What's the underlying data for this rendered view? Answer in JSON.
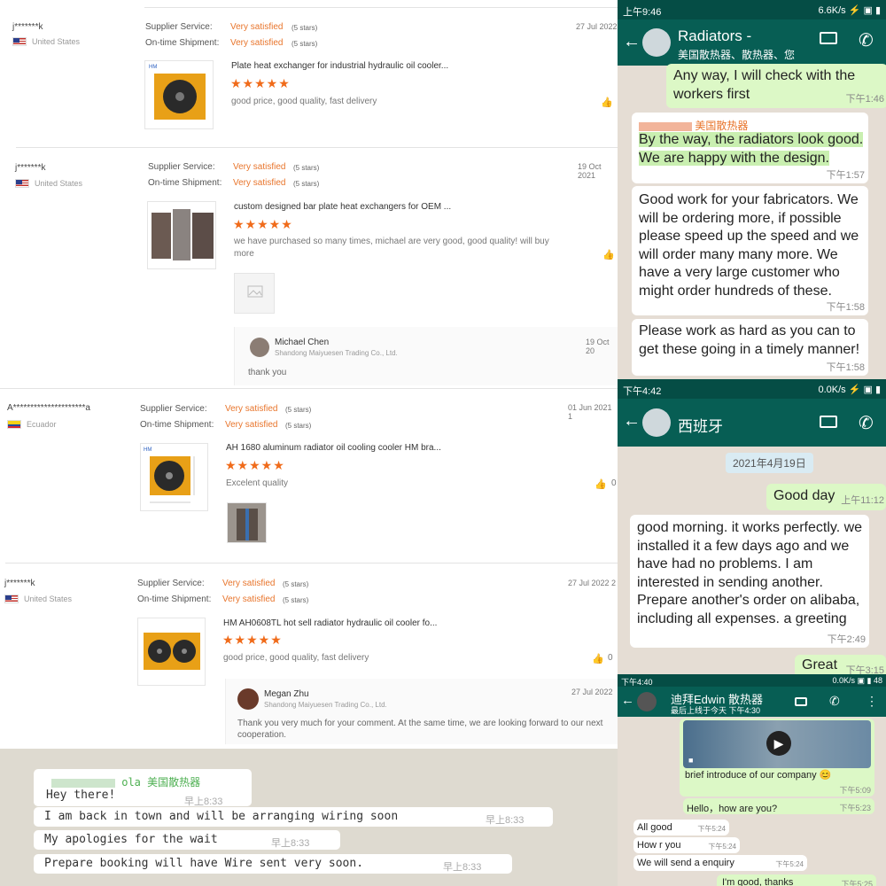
{
  "reviews": [
    {
      "user": "j*******k",
      "country": "United States",
      "flag": "us",
      "supplier_label": "Supplier Service:",
      "supplier_value": "Very satisfied",
      "supplier_stars": "(5 stars)",
      "shipment_label": "On-time Shipment:",
      "shipment_value": "Very satisfied",
      "shipment_stars": "(5 stars)",
      "date": "27 Jul 2022",
      "product": "Plate heat exchanger for industrial hydraulic oil cooler...",
      "stars": "★★★★★",
      "comment": "good price, good quality, fast delivery",
      "likes": ""
    },
    {
      "user": "j*******k",
      "country": "United States",
      "flag": "us",
      "supplier_label": "Supplier Service:",
      "supplier_value": "Very satisfied",
      "supplier_stars": "(5 stars)",
      "shipment_label": "On-time Shipment:",
      "shipment_value": "Very satisfied",
      "shipment_stars": "(5 stars)",
      "date": "19 Oct 2021",
      "product": "custom designed bar plate heat exchangers for OEM ...",
      "stars": "★★★★★",
      "comment": "we have purchased so many times, michael are very good, good quality! will buy more",
      "likes": "",
      "reply": {
        "name": "Michael Chen",
        "company": "Shandong Maiyuesen Trading Co., Ltd.",
        "date": "19 Oct 20",
        "text": "thank you"
      }
    },
    {
      "user": "A*********************a",
      "country": "Ecuador",
      "flag": "ec",
      "supplier_label": "Supplier Service:",
      "supplier_value": "Very satisfied",
      "supplier_stars": "(5 stars)",
      "shipment_label": "On-time Shipment:",
      "shipment_value": "Very satisfied",
      "shipment_stars": "(5 stars)",
      "date": "01 Jun 2021 1",
      "product": "AH 1680 aluminum radiator oil cooling cooler HM bra...",
      "stars": "★★★★★",
      "comment": "Excelent quality",
      "likes": "0"
    },
    {
      "user": "j*******k",
      "country": "United States",
      "flag": "us",
      "supplier_label": "Supplier Service:",
      "supplier_value": "Very satisfied",
      "supplier_stars": "(5 stars)",
      "shipment_label": "On-time Shipment:",
      "shipment_value": "Very satisfied",
      "shipment_stars": "(5 stars)",
      "date": "27 Jul 2022 2",
      "product": "HM AH0608TL hot sell radiator hydraulic oil cooler fo...",
      "stars": "★★★★★",
      "comment": "good price, good quality, fast delivery",
      "likes": "0",
      "reply": {
        "name": "Megan Zhu",
        "company": "Shandong Maiyuesen Trading Co., Ltd.",
        "date": "27 Jul 2022",
        "text": "Thank you very much for your comment. At the same time, we are looking forward to our next cooperation."
      }
    }
  ],
  "chat1": {
    "status_time": "上午9:46",
    "status_right": "6.6K/s ⚡ ▣ ▮",
    "title": "Radiators -",
    "subtitle": "美国散热器、散热器、您",
    "messages": [
      {
        "text": "Any way, I will check with the workers first",
        "time": "下午1:46"
      },
      {
        "sender": "美国散热器",
        "text": "By the way, the radiators look good. We are happy with the design.",
        "time": "下午1:57"
      },
      {
        "text": "Good work for your fabricators.  We will be ordering more, if possible please speed up the speed and we will order many many more.  We have a very large customer who might order hundreds of these.",
        "time": "下午1:58"
      },
      {
        "text": "Please work as hard as you can to get these going in a timely manner!",
        "time": "下午1:58"
      }
    ]
  },
  "chat2": {
    "status_time": "下午4:42",
    "status_right": "0.0K/s ⚡ ▣ ▮",
    "title": "西班牙",
    "date_chip": "2021年4月19日",
    "messages": [
      {
        "text": "Good day",
        "time": "上午11:12"
      },
      {
        "text": "good morning. it works perfectly. we installed it a few days ago and we have had no problems. I am interested in sending another. Prepare another's order on alibaba, including all expenses. a greeting",
        "time": "下午2:49"
      },
      {
        "text": "Great",
        "time": "下午3:15"
      }
    ]
  },
  "chat3": {
    "status_time": "下午4:40",
    "status_right": "0.0K/s ▣ ▮ 48",
    "title": "迪拜Edwin 散热器",
    "subtitle": "最后上线于今天 下午4:30",
    "messages": [
      {
        "text": "brief introduce of our company 😊",
        "time": "下午5:09"
      },
      {
        "text": "Hello，how are you?",
        "time": "下午5:23"
      },
      {
        "text": "All good",
        "time": "下午5:24"
      },
      {
        "text": "How r you",
        "time": "下午5:24"
      },
      {
        "text": "We will send a enquiry",
        "time": "下午5:24"
      },
      {
        "text": "I'm good, thanks",
        "time": "下午5:25"
      }
    ]
  },
  "chat4": {
    "sender": "ola 美国散热器",
    "messages": [
      {
        "text": "Hey there!",
        "time": "早上8:33"
      },
      {
        "text": "I am back in town and will be arranging wiring soon",
        "time": "早上8:33"
      },
      {
        "text": "My apologies for the wait",
        "time": "早上8:33"
      },
      {
        "text": "Prepare booking will have Wire sent very soon.",
        "time": "早上8:33"
      }
    ]
  },
  "colors": {
    "accent": "#e8752c",
    "star": "#f06b1a",
    "wa_green": "#075e54",
    "wa_out": "#dcf8c6"
  }
}
